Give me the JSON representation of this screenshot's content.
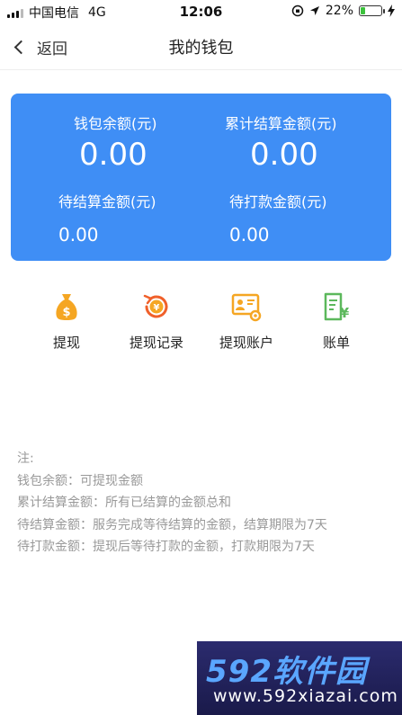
{
  "status_bar": {
    "carrier": "中国电信",
    "network": "4G",
    "time": "12:06",
    "battery": "22%"
  },
  "nav": {
    "back_label": "返回",
    "title": "我的钱包"
  },
  "wallet": {
    "balance_label": "钱包余额(元)",
    "balance_value": "0.00",
    "settled_total_label": "累计结算金额(元)",
    "settled_total_value": "0.00",
    "pending_settle_label": "待结算金额(元)",
    "pending_settle_value": "0.00",
    "pending_payment_label": "待打款金额(元)",
    "pending_payment_value": "0.00"
  },
  "actions": [
    {
      "label": "提现",
      "icon": "money-bag-icon"
    },
    {
      "label": "提现记录",
      "icon": "yuan-history-icon"
    },
    {
      "label": "提现账户",
      "icon": "account-card-icon"
    },
    {
      "label": "账单",
      "icon": "bill-icon"
    }
  ],
  "notes": {
    "title": "注:",
    "lines": [
      "钱包余额：可提现金额",
      "累计结算金额：所有已结算的金额总和",
      "待结算金额：服务完成等待结算的金额，结算期限为7天",
      "待打款金额：提现后等待打款的金额，打款期限为7天"
    ]
  },
  "watermark": {
    "brand": "592软件园",
    "url": "www.592xiazai.com"
  },
  "colors": {
    "card_blue": "#3f8ef5",
    "icon_orange": "#f5a623",
    "icon_red_orange": "#f0602a",
    "icon_green": "#5cb85c"
  }
}
